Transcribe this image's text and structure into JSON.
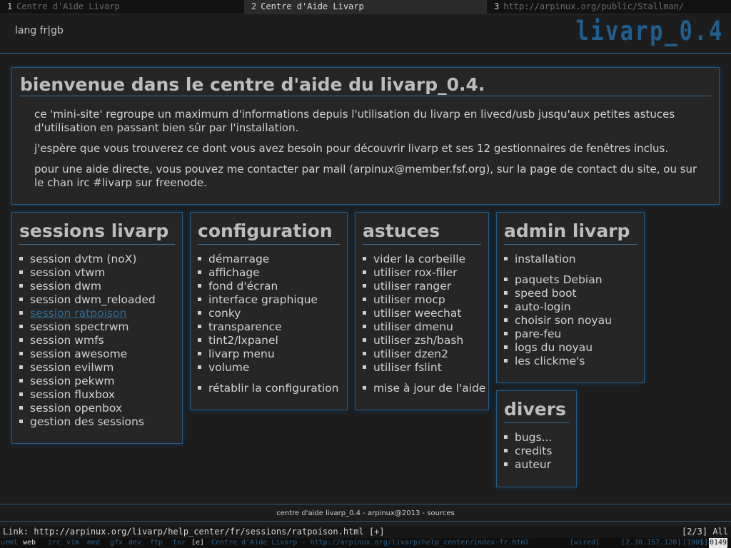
{
  "tabs": [
    {
      "num": "1",
      "title": "Centre d'Aide Livarp"
    },
    {
      "num": "2",
      "title": "Centre d'Aide Livarp"
    },
    {
      "num": "3",
      "title": "http://arpinux.org/public/Stallman/"
    }
  ],
  "header": {
    "lang": "lang fr|gb",
    "logo": "livarp_0.4"
  },
  "welcome": {
    "title": "bienvenue dans le centre d'aide du livarp_0.4.",
    "p1": "ce 'mini-site' regroupe un maximum d'informations depuis l'utilisation du livarp en livecd/usb jusqu'aux petites astuces d'utilisation en passant bien sûr par l'installation.",
    "p2": "j'espère que vous trouverez ce dont vous avez besoin pour découvrir livarp et ses 12 gestionnaires de fenêtres inclus.",
    "p3": "pour une aide directe, vous pouvez me contacter par mail (arpinux@member.fsf.org), sur la page de contact du site, ou sur le chan irc #livarp sur freenode."
  },
  "sessions": {
    "title": "sessions livarp",
    "items": [
      "session dvtm (noX)",
      "session vtwm",
      "session dwm",
      "session dwm_reloaded",
      "session ratpoison",
      "session spectrwm",
      "session wmfs",
      "session awesome",
      "session evilwm",
      "session pekwm",
      "session fluxbox",
      "session openbox",
      "gestion des sessions"
    ]
  },
  "configuration": {
    "title": "configuration",
    "items": [
      "démarrage",
      "affichage",
      "fond d'écran",
      "interface graphique",
      "conky",
      "transparence",
      "tint2/lxpanel",
      "livarp menu",
      "volume",
      "rétablir la configuration"
    ]
  },
  "astuces": {
    "title": "astuces",
    "items": [
      "vider la corbeille",
      "utiliser rox-filer",
      "utiliser ranger",
      "utiliser mocp",
      "utiliser weechat",
      "utiliser dmenu",
      "utiliser zsh/bash",
      "utiliser dzen2",
      "utiliser fslint",
      "mise à jour de l'aide"
    ]
  },
  "admin": {
    "title": "admin livarp",
    "items": [
      "installation",
      "paquets Debian",
      "speed boot",
      "auto-login",
      "choisir son noyau",
      "pare-feu",
      "logs du noyau",
      "les clickme's"
    ]
  },
  "divers": {
    "title": "divers",
    "items": [
      "bugs...",
      "credits",
      "auteur"
    ]
  },
  "footer": {
    "text": "centre d'aide livarp_0.4 - arpinux@2013 - sources"
  },
  "linkbar": {
    "link": "Link: http://arpinux.org/livarp/help_center/fr/sessions/ratpoison.html [+]",
    "position": "[2/3] All"
  },
  "statusbar": {
    "tags": [
      "ueml",
      "web",
      "irc",
      "vim",
      "med",
      "gfx",
      "dev",
      "ftp",
      "tor"
    ],
    "layout": "[e]",
    "title": "Centre d'Aide Livarp - http://arpinux.org/livarp/help_center/index-fr.html",
    "net": "[wired]",
    "ip": "[2.38.157.120]",
    "count": "[1905]",
    "clock": "[]",
    "time": "0149"
  },
  "colors": {
    "accent": "#245b86",
    "link": "#2c6a96",
    "background": "#1d1d1d",
    "panel": "#262626"
  }
}
